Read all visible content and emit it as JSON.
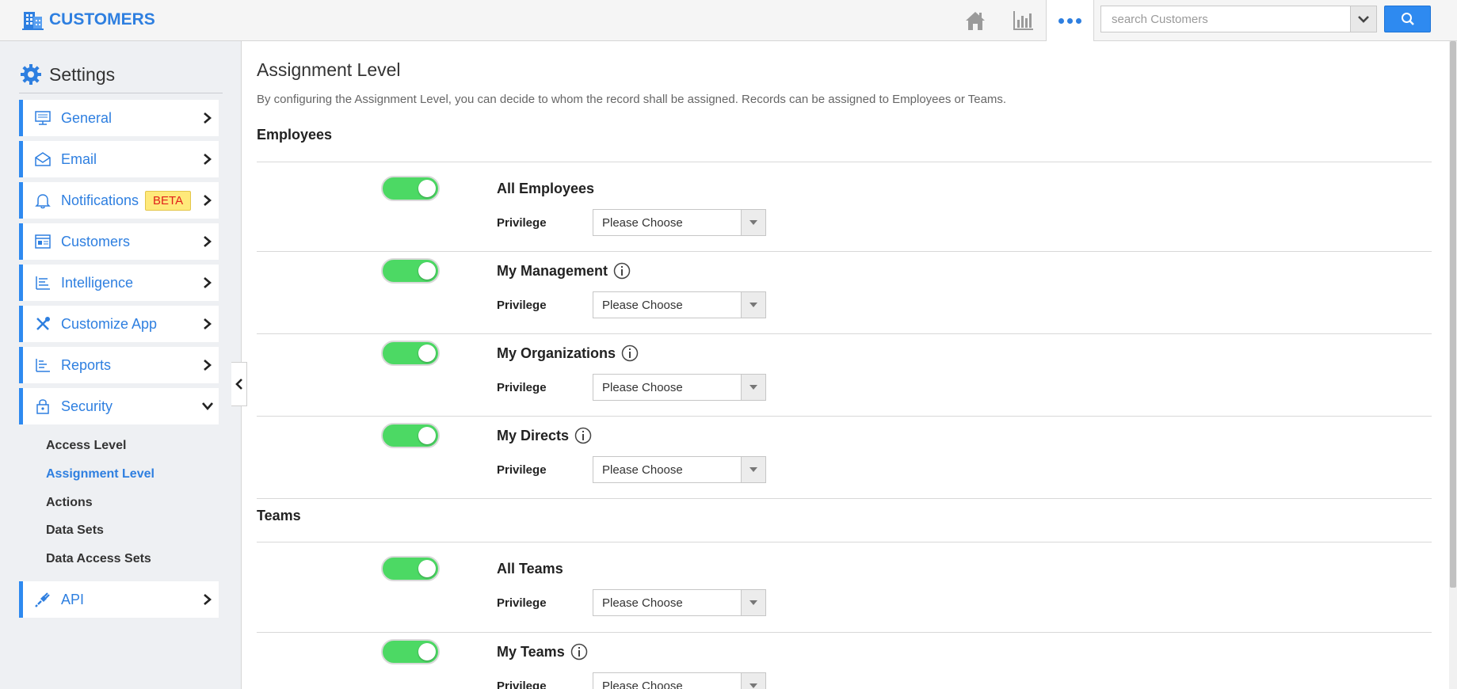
{
  "app": {
    "title": "CUSTOMERS"
  },
  "search": {
    "placeholder": "search Customers"
  },
  "sidebar": {
    "title": "Settings",
    "items": [
      {
        "label": "General"
      },
      {
        "label": "Email"
      },
      {
        "label": "Notifications",
        "badge": "BETA"
      },
      {
        "label": "Customers"
      },
      {
        "label": "Intelligence"
      },
      {
        "label": "Customize App"
      },
      {
        "label": "Reports"
      },
      {
        "label": "Security"
      },
      {
        "label": "API"
      }
    ],
    "security_sub": [
      {
        "label": "Access Level"
      },
      {
        "label": "Assignment Level"
      },
      {
        "label": "Actions"
      },
      {
        "label": "Data Sets"
      },
      {
        "label": "Data Access Sets"
      }
    ]
  },
  "main": {
    "title": "Assignment Level",
    "description": "By configuring the Assignment Level, you can decide to whom the record shall be assigned. Records can be assigned to Employees or Teams.",
    "privilege_label": "Privilege",
    "select_placeholder": "Please Choose",
    "sections": [
      {
        "title": "Employees",
        "rows": [
          {
            "title": "All Employees",
            "enabled": true
          },
          {
            "title": "My Management",
            "enabled": true
          },
          {
            "title": "My Organizations",
            "enabled": true
          },
          {
            "title": "My Directs",
            "enabled": true
          }
        ]
      },
      {
        "title": "Teams",
        "rows": [
          {
            "title": "All Teams",
            "enabled": true
          },
          {
            "title": "My Teams",
            "enabled": true
          }
        ]
      }
    ]
  },
  "colors": {
    "accent": "#2e7fe0",
    "toggle_on": "#4cd964",
    "beta_bg": "#ffe97a",
    "beta_text": "#e0201a"
  },
  "icons": {
    "brand": "building-icon",
    "home": "home-icon",
    "analytics": "bar-chart-icon",
    "more": "more-dots-icon",
    "search": "search-icon",
    "settings": "gear-icon",
    "info": "info-icon"
  }
}
